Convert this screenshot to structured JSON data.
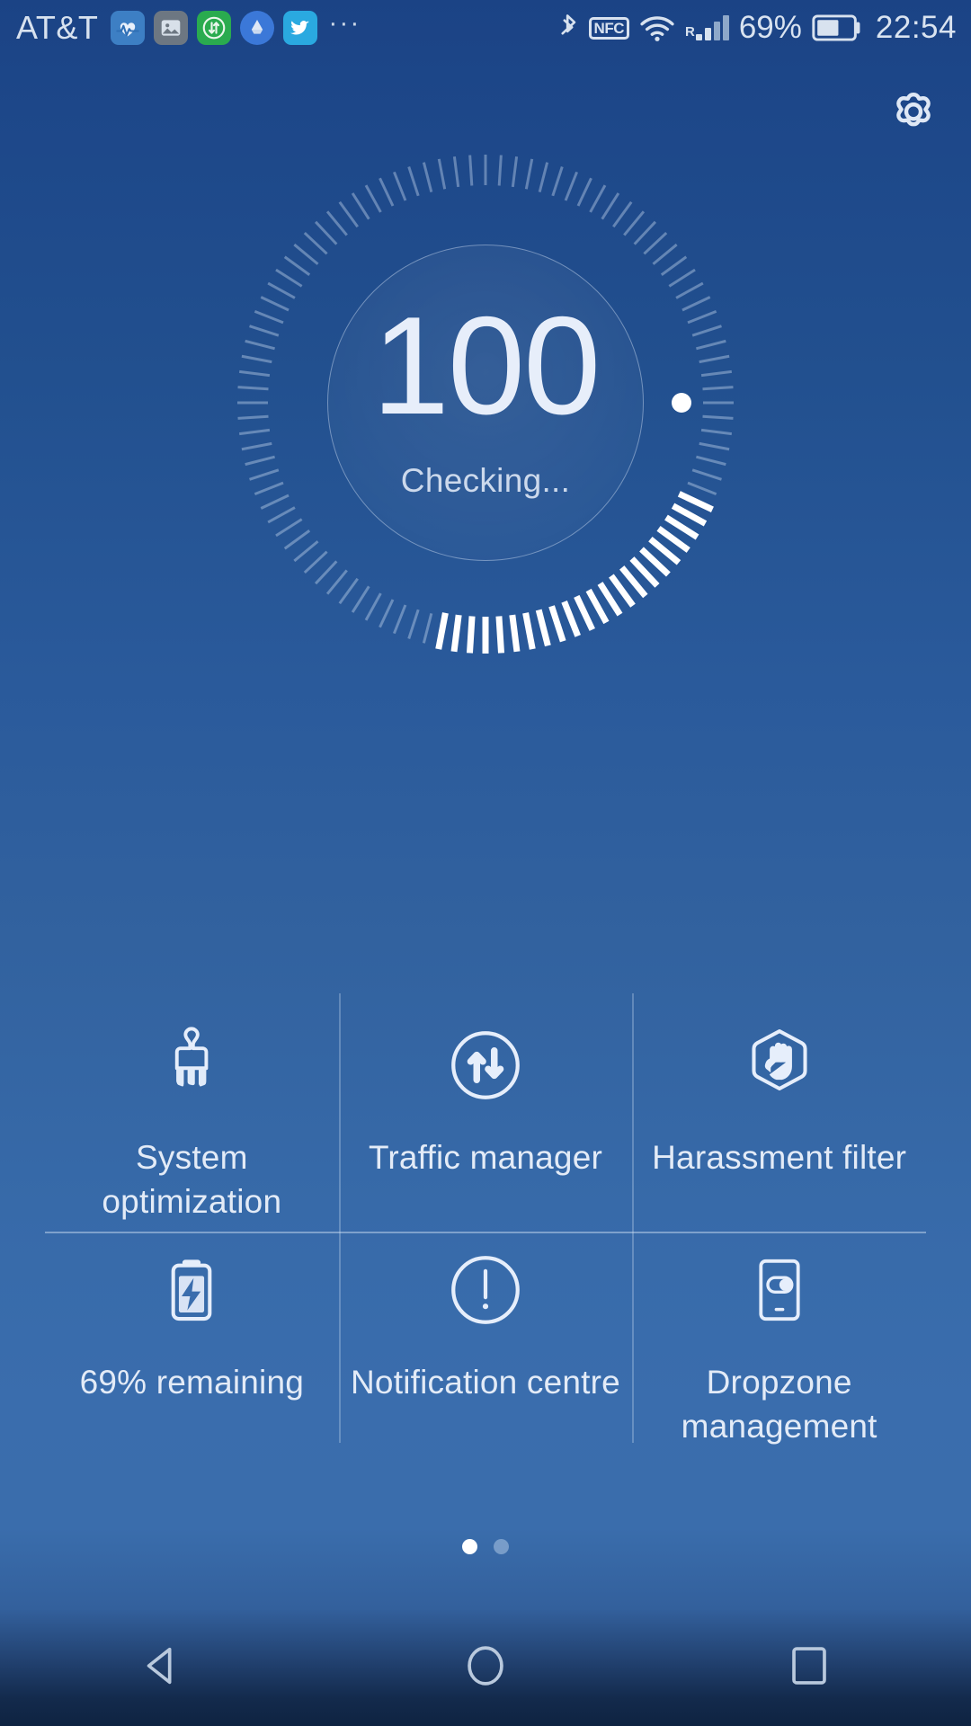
{
  "status_bar": {
    "carrier": "AT&T",
    "app_icons": [
      {
        "name": "health-app-icon"
      },
      {
        "name": "photos-app-icon"
      },
      {
        "name": "green-transfer-app-icon"
      },
      {
        "name": "google-drive-app-icon"
      },
      {
        "name": "twitter-app-icon"
      }
    ],
    "overflow": "···",
    "nfc_label": "NFC",
    "roaming_label": "R",
    "battery_percent": "69%",
    "clock": "22:54"
  },
  "header": {
    "settings_label": "Settings"
  },
  "dial": {
    "score": "100",
    "status": "Checking...",
    "total_ticks": 100,
    "highlight_start": 57,
    "highlight_count": 22,
    "marker_angle_deg": 180
  },
  "features": [
    {
      "id": "system-optimization",
      "icon": "broom-icon",
      "label_lines": [
        "System",
        "optimization"
      ],
      "label": "System optimization"
    },
    {
      "id": "traffic-manager",
      "icon": "data-transfer-icon",
      "label_lines": [
        "Traffic manager"
      ],
      "label": "Traffic manager"
    },
    {
      "id": "harassment-filter",
      "icon": "stop-hand-icon",
      "label_lines": [
        "Harassment filter"
      ],
      "label": "Harassment filter"
    },
    {
      "id": "battery-remaining",
      "icon": "battery-charge-icon",
      "label_lines": [
        "69% remaining"
      ],
      "label": "69% remaining"
    },
    {
      "id": "notification-centre",
      "icon": "exclamation-circle-icon",
      "label_lines": [
        "Notification centre"
      ],
      "label": "Notification centre"
    },
    {
      "id": "dropzone-management",
      "icon": "phone-toggle-icon",
      "label_lines": [
        "Dropzone",
        "management"
      ],
      "label": "Dropzone management"
    }
  ],
  "pagination": {
    "pages": 2,
    "active_index": 0
  },
  "nav_bar": {
    "back": "Back",
    "home": "Home",
    "recents": "Recents"
  },
  "colors": {
    "background_top": "#1b4385",
    "background_mid": "#3a6dad",
    "background_bottom": "#0e2341",
    "text_primary": "#e7eefa",
    "text_secondary": "#ccd9ec",
    "accent_white": "#ffffff"
  }
}
